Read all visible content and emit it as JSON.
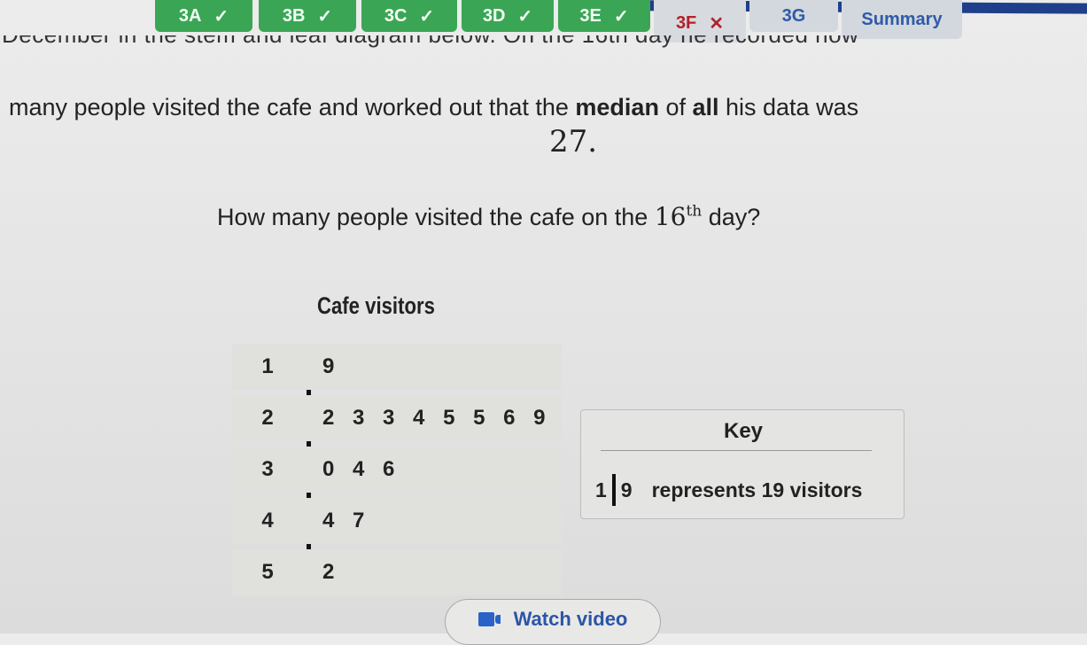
{
  "tabs": [
    {
      "label": "3A",
      "status": "correct",
      "mark": "✓"
    },
    {
      "label": "3B",
      "status": "correct",
      "mark": "✓"
    },
    {
      "label": "3C",
      "status": "correct",
      "mark": "✓"
    },
    {
      "label": "3D",
      "status": "correct",
      "mark": "✓"
    },
    {
      "label": "3E",
      "status": "correct",
      "mark": "✓"
    },
    {
      "label": "3F",
      "status": "incorrect",
      "mark": "✕"
    },
    {
      "label": "3G",
      "status": "unanswered",
      "mark": ""
    },
    {
      "label": "Summary",
      "status": "summary",
      "mark": ""
    }
  ],
  "colors": {
    "correct_tab": "#3aa655",
    "incorrect_text": "#b3212b",
    "pending_text": "#2f5aa8",
    "header_blue": "#1f3f8a",
    "video_blue": "#2a63c7"
  },
  "question": {
    "clipped_line": "December in the stem and leaf diagram below. On the 16th day he recorded how",
    "line1_before": "many people visited the cafe and worked out that the ",
    "line1_bold1": "median",
    "line1_mid": " of ",
    "line1_bold2": "all",
    "line1_after": " his data was",
    "median_value": "27.",
    "prompt_before": "How many people visited the cafe on the ",
    "prompt_number": "16",
    "prompt_sup": "th",
    "prompt_after": " day?"
  },
  "stem_leaf": {
    "title": "Cafe visitors",
    "rows": [
      {
        "stem": "1",
        "leaves": "9"
      },
      {
        "stem": "2",
        "leaves": "2 3 3 4 5 5 6 9"
      },
      {
        "stem": "3",
        "leaves": "0 4 6"
      },
      {
        "stem": "4",
        "leaves": "4 7"
      },
      {
        "stem": "5",
        "leaves": "2"
      }
    ]
  },
  "key": {
    "title": "Key",
    "stem": "1",
    "leaf": "9",
    "description": "represents 19 visitors"
  },
  "watch_video": {
    "label": "Watch video",
    "icon": "video-camera-icon"
  }
}
